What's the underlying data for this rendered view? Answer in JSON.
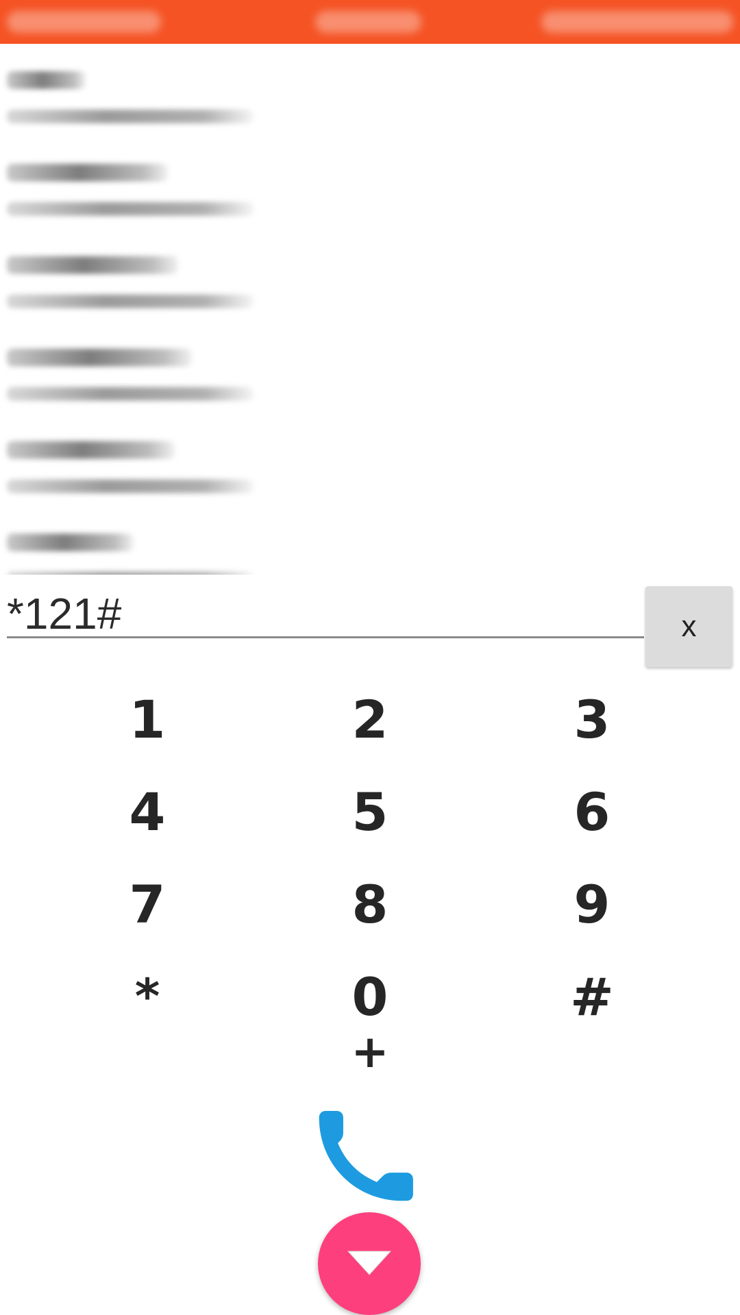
{
  "dialer": {
    "number": "*121#",
    "clear_label": "x"
  },
  "keypad": {
    "keys": [
      "1",
      "2",
      "3",
      "4",
      "5",
      "6",
      "7",
      "8",
      "9",
      "*",
      "0",
      "#"
    ],
    "plus": "+"
  },
  "colors": {
    "app_bar": "#f55324",
    "call_icon": "#1e9be0",
    "collapse_button": "#fd3f7d",
    "clear_button": "#dcdcdc"
  },
  "icons": {
    "call": "phone-icon",
    "collapse": "triangle-down-icon"
  }
}
